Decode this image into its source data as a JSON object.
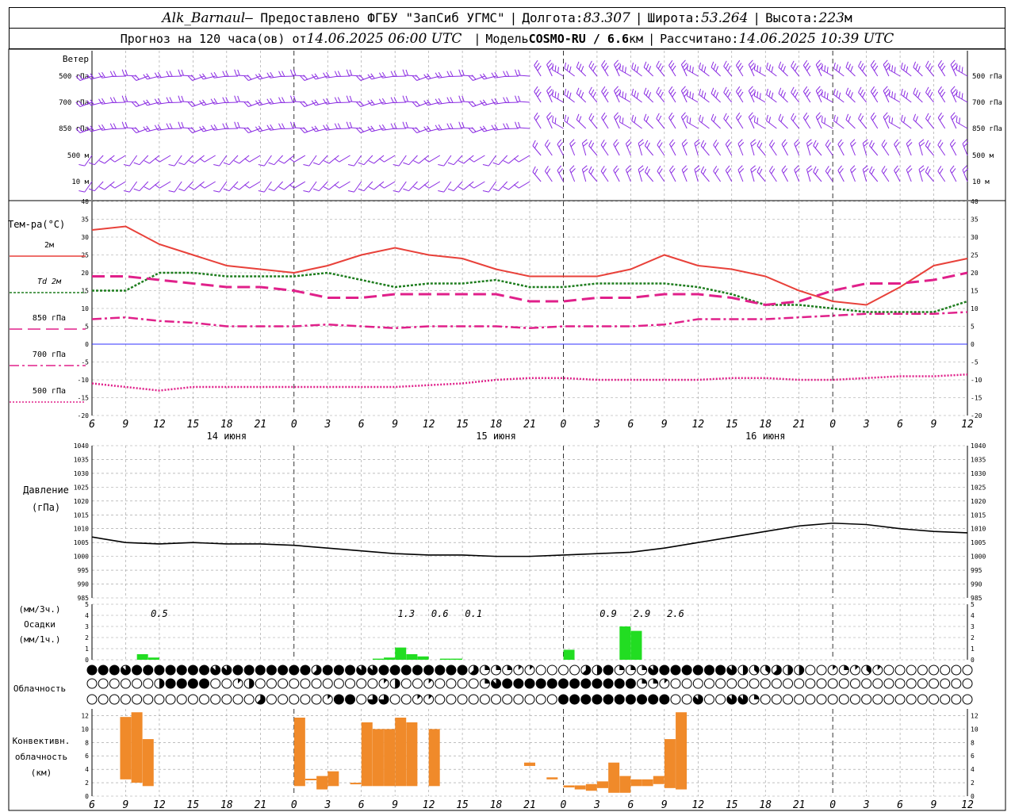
{
  "header": {
    "station": "Alk_Barnaul",
    "provider": "— Предоставлено ФГБУ \"ЗапСиб УГМС\"",
    "lon_label": "Долгота:",
    "lon": "83.307",
    "lat_label": "Широта:",
    "lat": "53.264",
    "alt_label": "Высота:",
    "alt": "223",
    "alt_unit": "м",
    "forecast_label": "Прогноз на 120 часа(ов) от",
    "forecast_time": "14.06.2025 06:00 UTC",
    "model_label": "Модель",
    "model": "COSMO-RU / 6.6",
    "model_unit": "км",
    "calc_label": "Рассчитано:",
    "calc_time": "14.06.2025 10:39 UTC"
  },
  "colors": {
    "wind": "#8a2be2",
    "t2m": "#e8413a",
    "td2m": "#1e7d1e",
    "t850": "#e0208a",
    "t700": "#e0208a",
    "t500": "#e0208a",
    "zero": "#3030ff",
    "pressure": "#000000",
    "precip": "#22dd22",
    "conv": "#f08a2a"
  },
  "time_axis": {
    "hour_labels": [
      "6",
      "9",
      "12",
      "15",
      "18",
      "21",
      "0",
      "3",
      "6",
      "9",
      "12",
      "15",
      "18",
      "21",
      "0",
      "3",
      "6",
      "9",
      "12",
      "15",
      "18",
      "21",
      "0",
      "3",
      "6",
      "9",
      "12"
    ],
    "day_labels": [
      {
        "label": "14 июня",
        "at_hour": 12
      },
      {
        "label": "15 июня",
        "at_hour": 36
      },
      {
        "label": "16 июня",
        "at_hour": 60
      }
    ],
    "midnight_hours": [
      18,
      42,
      66,
      90
    ]
  },
  "wind": {
    "title": "Ветер",
    "levels": [
      "500 гПа",
      "700 гПа",
      "850 гПа",
      "500 м",
      "10 м"
    ],
    "icon": "wind-barb-icon"
  },
  "chart_data": [
    {
      "type": "line",
      "title": "Тем-ра(°C)",
      "ylim": [
        -20,
        40
      ],
      "y_ticks": [
        40,
        35,
        30,
        25,
        20,
        15,
        10,
        5,
        0,
        -5,
        -10,
        -15,
        -20
      ],
      "x_hours": [
        0,
        3,
        6,
        9,
        12,
        15,
        18,
        21,
        24,
        27,
        30,
        33,
        36,
        39,
        42,
        45,
        48,
        51,
        54,
        57,
        60,
        63,
        66,
        69,
        72,
        75,
        78
      ],
      "legend": [
        "2м",
        "Td  2м",
        "850 гПа",
        "700 гПа",
        "500 гПа"
      ],
      "series": [
        {
          "name": "2м",
          "values": [
            32,
            33,
            28,
            25,
            22,
            21,
            20,
            22,
            25,
            27,
            25,
            24,
            21,
            19,
            19,
            19,
            21,
            25,
            22,
            21,
            19,
            15,
            12,
            11,
            16,
            22,
            24
          ]
        },
        {
          "name": "Td  2м",
          "values": [
            15,
            15,
            20,
            20,
            19,
            19,
            19,
            20,
            18,
            16,
            17,
            17,
            18,
            16,
            16,
            17,
            17,
            17,
            16,
            14,
            11,
            11,
            10,
            9,
            9,
            9,
            12
          ]
        },
        {
          "name": "850 гПа",
          "values": [
            19,
            19,
            18,
            17,
            16,
            16,
            15,
            13,
            13,
            14,
            14,
            14,
            14,
            12,
            12,
            13,
            13,
            14,
            14,
            13,
            11,
            12,
            15,
            17,
            17,
            18,
            20
          ]
        },
        {
          "name": "700 гПа",
          "values": [
            7,
            7.5,
            6.5,
            6,
            5,
            5,
            5,
            5.5,
            5,
            4.5,
            5,
            5,
            5,
            4.5,
            5,
            5,
            5,
            5.5,
            7,
            7,
            7,
            7.5,
            8,
            8.5,
            8.5,
            8.5,
            9
          ]
        },
        {
          "name": "500 гПа",
          "values": [
            -11,
            -12,
            -13,
            -12,
            -12,
            -12,
            -12,
            -12,
            -12,
            -12,
            -11.5,
            -11,
            -10,
            -9.5,
            -9.5,
            -10,
            -10,
            -10,
            -10,
            -9.5,
            -9.5,
            -10,
            -10,
            -9.5,
            -9,
            -9,
            -8.5
          ]
        }
      ]
    },
    {
      "type": "line",
      "title": "Давление",
      "ylabel": "(гПа)",
      "ylim": [
        985,
        1040
      ],
      "y_ticks": [
        1040,
        1035,
        1030,
        1025,
        1020,
        1015,
        1010,
        1005,
        1000,
        995,
        990,
        985
      ],
      "x_hours": [
        0,
        3,
        6,
        9,
        12,
        15,
        18,
        21,
        24,
        27,
        30,
        33,
        36,
        39,
        42,
        45,
        48,
        51,
        54,
        57,
        60,
        63,
        66,
        69,
        72,
        75,
        78
      ],
      "series": [
        {
          "name": "Давление",
          "values": [
            1007,
            1005,
            1004.5,
            1005,
            1004.5,
            1004.5,
            1004,
            1003,
            1002,
            1001,
            1000.5,
            1000.5,
            1000,
            1000,
            1000.5,
            1001,
            1001.5,
            1003,
            1005,
            1007,
            1009,
            1011,
            1012,
            1011.5,
            1010,
            1009,
            1008.5
          ]
        }
      ]
    },
    {
      "type": "bar",
      "title": "Осадки",
      "ylabel": "(мм/3ч.)",
      "ylabel2": "(мм/1ч.)",
      "ylim": [
        0,
        5
      ],
      "y_ticks": [
        5,
        4,
        3,
        2,
        1,
        0
      ],
      "annotations": [
        {
          "hour": 6,
          "text": "0.5"
        },
        {
          "hour": 28,
          "text": "1.3"
        },
        {
          "hour": 31,
          "text": "0.6"
        },
        {
          "hour": 34,
          "text": "0.1"
        },
        {
          "hour": 46,
          "text": "0.9"
        },
        {
          "hour": 49,
          "text": "2.9"
        },
        {
          "hour": 52,
          "text": "2.6"
        }
      ],
      "bars": [
        {
          "hour": 4.5,
          "value": 0.5
        },
        {
          "hour": 5.5,
          "value": 0.2
        },
        {
          "hour": 25.5,
          "value": 0.1
        },
        {
          "hour": 26.5,
          "value": 0.2
        },
        {
          "hour": 27.5,
          "value": 1.1
        },
        {
          "hour": 28.5,
          "value": 0.5
        },
        {
          "hour": 29.5,
          "value": 0.3
        },
        {
          "hour": 31.5,
          "value": 0.1
        },
        {
          "hour": 32.5,
          "value": 0.1
        },
        {
          "hour": 42.5,
          "value": 0.9
        },
        {
          "hour": 47.5,
          "value": 3.0
        },
        {
          "hour": 48.5,
          "value": 2.6
        }
      ]
    },
    {
      "type": "table",
      "title": "Облачность",
      "rows": [
        "8887888888877888888858887788888888522211000054822278888887433544001213100000000",
        "0000004888800140000000000014001000027888888888888221000000000000000000000000000",
        "0000000000000005000001880660011000000000008888888888007007720000000000000000000"
      ]
    },
    {
      "type": "bar",
      "title": "Конвективн. облачность",
      "ylabel": "(км)",
      "ylim": [
        0,
        13
      ],
      "y_ticks": [
        12,
        10,
        8,
        6,
        4,
        2,
        0
      ],
      "bars": [
        {
          "hour": 3,
          "base": 2.5,
          "top": 11.8
        },
        {
          "hour": 4,
          "base": 2.0,
          "top": 12.5
        },
        {
          "hour": 5,
          "base": 1.5,
          "top": 8.5
        },
        {
          "hour": 18.5,
          "base": 1.5,
          "top": 11.7
        },
        {
          "hour": 19.5,
          "base": 2.5,
          "top": 2.6
        },
        {
          "hour": 20.5,
          "base": 1.0,
          "top": 3.0
        },
        {
          "hour": 21.5,
          "base": 1.5,
          "top": 3.7
        },
        {
          "hour": 23.5,
          "base": 1.8,
          "top": 2.0
        },
        {
          "hour": 24.5,
          "base": 1.5,
          "top": 11.0
        },
        {
          "hour": 25.5,
          "base": 1.5,
          "top": 10.0
        },
        {
          "hour": 26.5,
          "base": 1.5,
          "top": 10.0
        },
        {
          "hour": 27.5,
          "base": 1.5,
          "top": 11.7
        },
        {
          "hour": 28.5,
          "base": 1.5,
          "top": 11.0
        },
        {
          "hour": 30.5,
          "base": 1.5,
          "top": 10.0
        },
        {
          "hour": 39,
          "base": 4.5,
          "top": 5.0
        },
        {
          "hour": 41,
          "base": 2.5,
          "top": 2.8
        },
        {
          "hour": 42.5,
          "base": 1.3,
          "top": 1.6
        },
        {
          "hour": 43.5,
          "base": 1.0,
          "top": 1.6
        },
        {
          "hour": 44.5,
          "base": 0.8,
          "top": 1.8
        },
        {
          "hour": 45.5,
          "base": 1.2,
          "top": 2.2
        },
        {
          "hour": 46.5,
          "base": 0.5,
          "top": 5.0
        },
        {
          "hour": 47.5,
          "base": 0.5,
          "top": 3.0
        },
        {
          "hour": 48.5,
          "base": 1.5,
          "top": 2.5
        },
        {
          "hour": 49.5,
          "base": 1.5,
          "top": 2.5
        },
        {
          "hour": 50.5,
          "base": 1.8,
          "top": 3.0
        },
        {
          "hour": 51.5,
          "base": 1.2,
          "top": 8.5
        },
        {
          "hour": 52.5,
          "base": 1.0,
          "top": 12.5
        }
      ]
    }
  ]
}
